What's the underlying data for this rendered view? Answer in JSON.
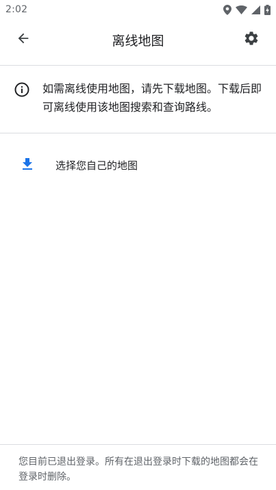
{
  "status_bar": {
    "time": "2:02",
    "icons": [
      "location-icon",
      "wifi-icon",
      "signal-icon",
      "battery-charging-icon"
    ]
  },
  "app_bar": {
    "title": "离线地图",
    "back_icon": "arrow-left-icon",
    "settings_icon": "gear-icon"
  },
  "info": {
    "icon": "info-icon",
    "text": "如需离线使用地图，请先下载地图。下载后即可离线使用该地图搜索和查询路线。"
  },
  "pick_map": {
    "icon": "download-icon",
    "label": "选择您自己的地图",
    "icon_color": "#1a73e8"
  },
  "footer": {
    "text": "您目前已退出登录。所有在退出登录时下载的地图都会在登录时删除。"
  },
  "colors": {
    "primary_text": "#202124",
    "secondary_text": "#5f6368",
    "divider": "#dadce0",
    "accent": "#1a73e8"
  }
}
